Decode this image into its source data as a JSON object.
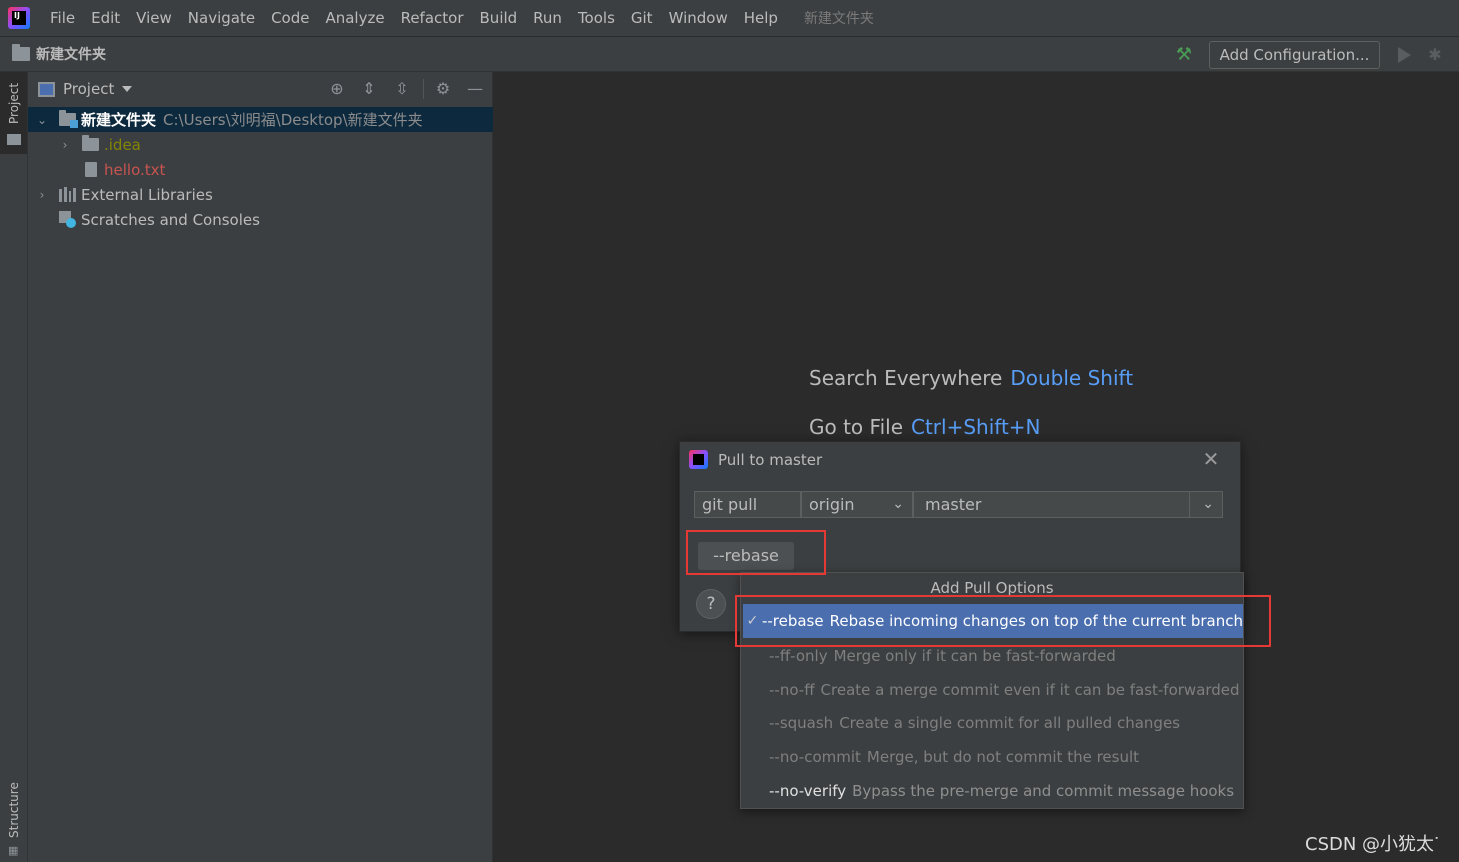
{
  "menubar": {
    "items": [
      "File",
      "Edit",
      "View",
      "Navigate",
      "Code",
      "Analyze",
      "Refactor",
      "Build",
      "Run",
      "Tools",
      "Git",
      "Window",
      "Help"
    ],
    "project_name": "新建文件夹"
  },
  "navbar": {
    "breadcrumb": "新建文件夹",
    "add_configuration": "Add Configuration..."
  },
  "left_stripe": {
    "project_tab": "Project",
    "structure_tab": "Structure"
  },
  "project_panel": {
    "title": "Project",
    "tree": {
      "root_name": "新建文件夹",
      "root_path": "C:\\Users\\刘明福\\Desktop\\新建文件夹",
      "idea_folder": ".idea",
      "hello_file": "hello.txt",
      "external_libraries": "External Libraries",
      "scratches": "Scratches and Consoles"
    }
  },
  "editor": {
    "hints": [
      {
        "label": "Search Everywhere",
        "key": "Double Shift"
      },
      {
        "label": "Go to File",
        "key": "Ctrl+Shift+N"
      }
    ]
  },
  "dialog": {
    "title": "Pull to master",
    "command": "git pull",
    "remote": "origin",
    "branch": "master",
    "rebase_chip": "--rebase",
    "help": "?"
  },
  "pull_options": {
    "title": "Add Pull Options",
    "options": [
      {
        "flag": "--rebase",
        "desc": "Rebase incoming changes on top of the current branch",
        "checked": true
      },
      {
        "flag": "--ff-only",
        "desc": "Merge only if it can be fast-forwarded"
      },
      {
        "flag": "--no-ff",
        "desc": "Create a merge commit even if it can be fast-forwarded"
      },
      {
        "flag": "--squash",
        "desc": "Create a single commit for all pulled changes"
      },
      {
        "flag": "--no-commit",
        "desc": "Merge, but do not commit the result"
      },
      {
        "flag": "--no-verify",
        "desc": "Bypass the pre-merge and commit message hooks"
      }
    ]
  },
  "watermark": "CSDN @小犹太ᐝ",
  "colors": {
    "accent": "#4b6eaf",
    "highlight_box": "#e53935",
    "hint_key": "#589df6",
    "modified_file": "#c75450",
    "ignored_folder": "#848504"
  }
}
